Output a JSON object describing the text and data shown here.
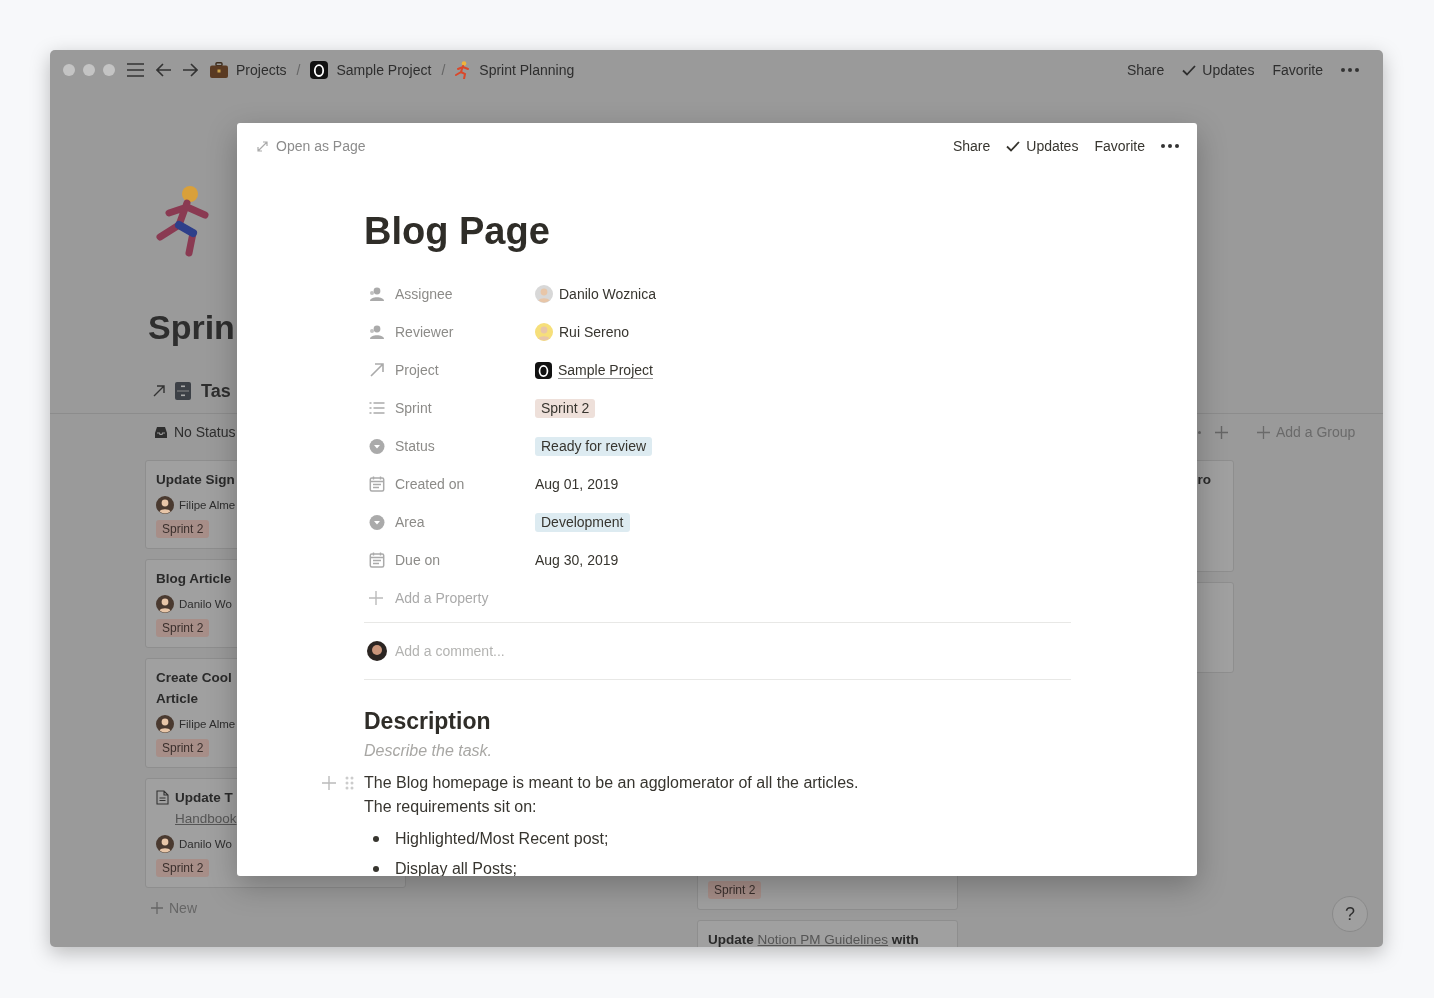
{
  "top_bar": {
    "breadcrumbs": [
      {
        "label": "Projects"
      },
      {
        "separator": "/",
        "label": "Sample Project"
      },
      {
        "separator": "/",
        "label": "Sprint Planning"
      }
    ],
    "actions": [
      {
        "label": "Share",
        "kind": "plain"
      },
      {
        "label": "Updates",
        "kind": "check"
      },
      {
        "label": "Favorite",
        "kind": "plain"
      }
    ]
  },
  "page": {
    "title": "Sprin",
    "view": "Tas"
  },
  "board": {
    "columns": [
      {
        "header": "No Status",
        "cards": [
          {
            "kind": "task",
            "title": [
              [
                {
                  "text": "Update Sign"
                }
              ]
            ],
            "person": "Filipe Alme",
            "tag": "Sprint 2"
          },
          {
            "kind": "task",
            "title": [
              [
                {
                  "text": "Blog Article"
                }
              ]
            ],
            "person": "Danilo Wo",
            "tag": "Sprint 2"
          },
          {
            "kind": "task",
            "title": [
              [
                {
                  "text": "Create Cool"
                }
              ],
              [
                {
                  "text": "Article"
                }
              ]
            ],
            "person": "Filipe Alme",
            "tag": "Sprint 2"
          },
          {
            "kind": "task",
            "doc": true,
            "title": [
              [
                {
                  "text": "Update T"
                }
              ],
              [
                {
                  "text": "Handbook",
                  "link": true
                }
              ]
            ],
            "person": "Danilo Wo",
            "tag": "Sprint 2"
          }
        ],
        "new_label": "New"
      },
      {
        "cards": [
          {
            "kind": "task",
            "tag": "Sprint 2"
          },
          {
            "kind": "task",
            "title": [
              [
                {
                  "text": "Update "
                },
                {
                  "text": "Notion PM Guidelines",
                  "link": true
                },
                {
                  "text": " with"
                }
              ]
            ]
          }
        ]
      },
      {
        "header_tools": true,
        "cards": [
          {
            "kind": "task",
            "title": [
              [
                {
                  "text": "ro"
                }
              ]
            ]
          },
          {
            "kind": "blank"
          }
        ]
      }
    ],
    "add_group": "Add a Group"
  },
  "help": "?",
  "modal": {
    "open_as_page": "Open as Page",
    "actions": [
      {
        "label": "Share",
        "kind": "plain"
      },
      {
        "label": "Updates",
        "kind": "check"
      },
      {
        "label": "Favorite",
        "kind": "plain"
      }
    ],
    "title": "Blog Page",
    "properties": [
      {
        "label": "Assignee",
        "kind": "person",
        "value": "Danilo Woznica"
      },
      {
        "label": "Reviewer",
        "kind": "person",
        "value": "Rui Sereno"
      },
      {
        "label": "Project",
        "kind": "relation",
        "value": "Sample Project"
      },
      {
        "label": "Sprint",
        "kind": "multi_select",
        "value": "Sprint 2",
        "color": "#eee0da"
      },
      {
        "label": "Status",
        "kind": "select",
        "value": "Ready for review",
        "color": "#ddebf1"
      },
      {
        "label": "Created on",
        "kind": "date",
        "value": "Aug 01, 2019"
      },
      {
        "label": "Area",
        "kind": "select",
        "value": "Development",
        "color": "#ddebf1"
      },
      {
        "label": "Due on",
        "kind": "date",
        "value": "Aug 30, 2019"
      }
    ],
    "add_property": "Add a Property",
    "comment_placeholder": "Add a comment...",
    "description": {
      "heading": "Description",
      "placeholder": "Describe the task.",
      "paragraph": [
        "The Blog homepage is meant to be an agglomerator of all the articles.",
        "The requirements sit on:"
      ],
      "bullets": [
        "Highlighted/Most Recent post;",
        "Display all Posts;"
      ]
    }
  }
}
